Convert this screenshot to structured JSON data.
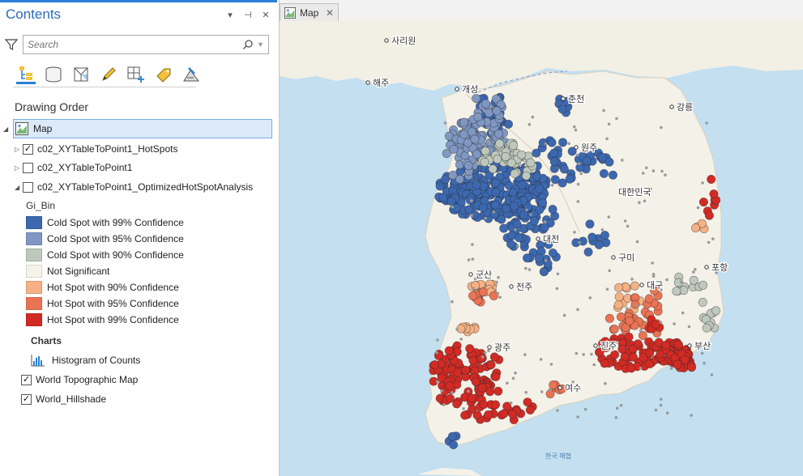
{
  "contents": {
    "title": "Contents",
    "ctrl_menu": "▾",
    "ctrl_pin": "⊣",
    "ctrl_close": "✕",
    "search": {
      "placeholder": "Search"
    },
    "section_title": "Drawing Order",
    "map_label": "Map",
    "layers": [
      {
        "label": "c02_XYTableToPoint1_HotSpots",
        "checked": true,
        "expanded": false
      },
      {
        "label": "c02_XYTableToPoint1",
        "checked": false,
        "expanded": false
      },
      {
        "label": "c02_XYTableToPoint1_OptimizedHotSpotAnalysis",
        "checked": false,
        "expanded": true
      }
    ],
    "legend_field": "Gi_Bin",
    "legend": [
      {
        "label": "Cold Spot with 99% Confidence",
        "color": "#3c68b0"
      },
      {
        "label": "Cold Spot with 95% Confidence",
        "color": "#7f97c2"
      },
      {
        "label": "Cold Spot with 90% Confidence",
        "color": "#bfc8bc"
      },
      {
        "label": "Not Significant",
        "color": "#f5f3ea"
      },
      {
        "label": "Hot Spot with 90% Confidence",
        "color": "#f5b184"
      },
      {
        "label": "Hot Spot with 95% Confidence",
        "color": "#ea7353"
      },
      {
        "label": "Hot Spot with 99% Confidence",
        "color": "#d22a24"
      }
    ],
    "charts_header": "Charts",
    "chart_item": "Histogram of Counts",
    "basemaps": [
      {
        "label": "World Topographic Map",
        "checked": true
      },
      {
        "label": "World_Hillshade",
        "checked": true
      }
    ]
  },
  "map": {
    "tab_label": "Map",
    "labels": [
      {
        "text": "사리원"
      },
      {
        "text": "해주"
      },
      {
        "text": "개성"
      },
      {
        "text": "춘천"
      },
      {
        "text": "강릉"
      },
      {
        "text": "원주"
      },
      {
        "text": "대한민국"
      },
      {
        "text": "대전"
      },
      {
        "text": "구미"
      },
      {
        "text": "포항"
      },
      {
        "text": "군산"
      },
      {
        "text": "전주"
      },
      {
        "text": "대구"
      },
      {
        "text": "광주"
      },
      {
        "text": "진주"
      },
      {
        "text": "부산"
      },
      {
        "text": "여수"
      },
      {
        "text": "한국 해협"
      }
    ]
  }
}
